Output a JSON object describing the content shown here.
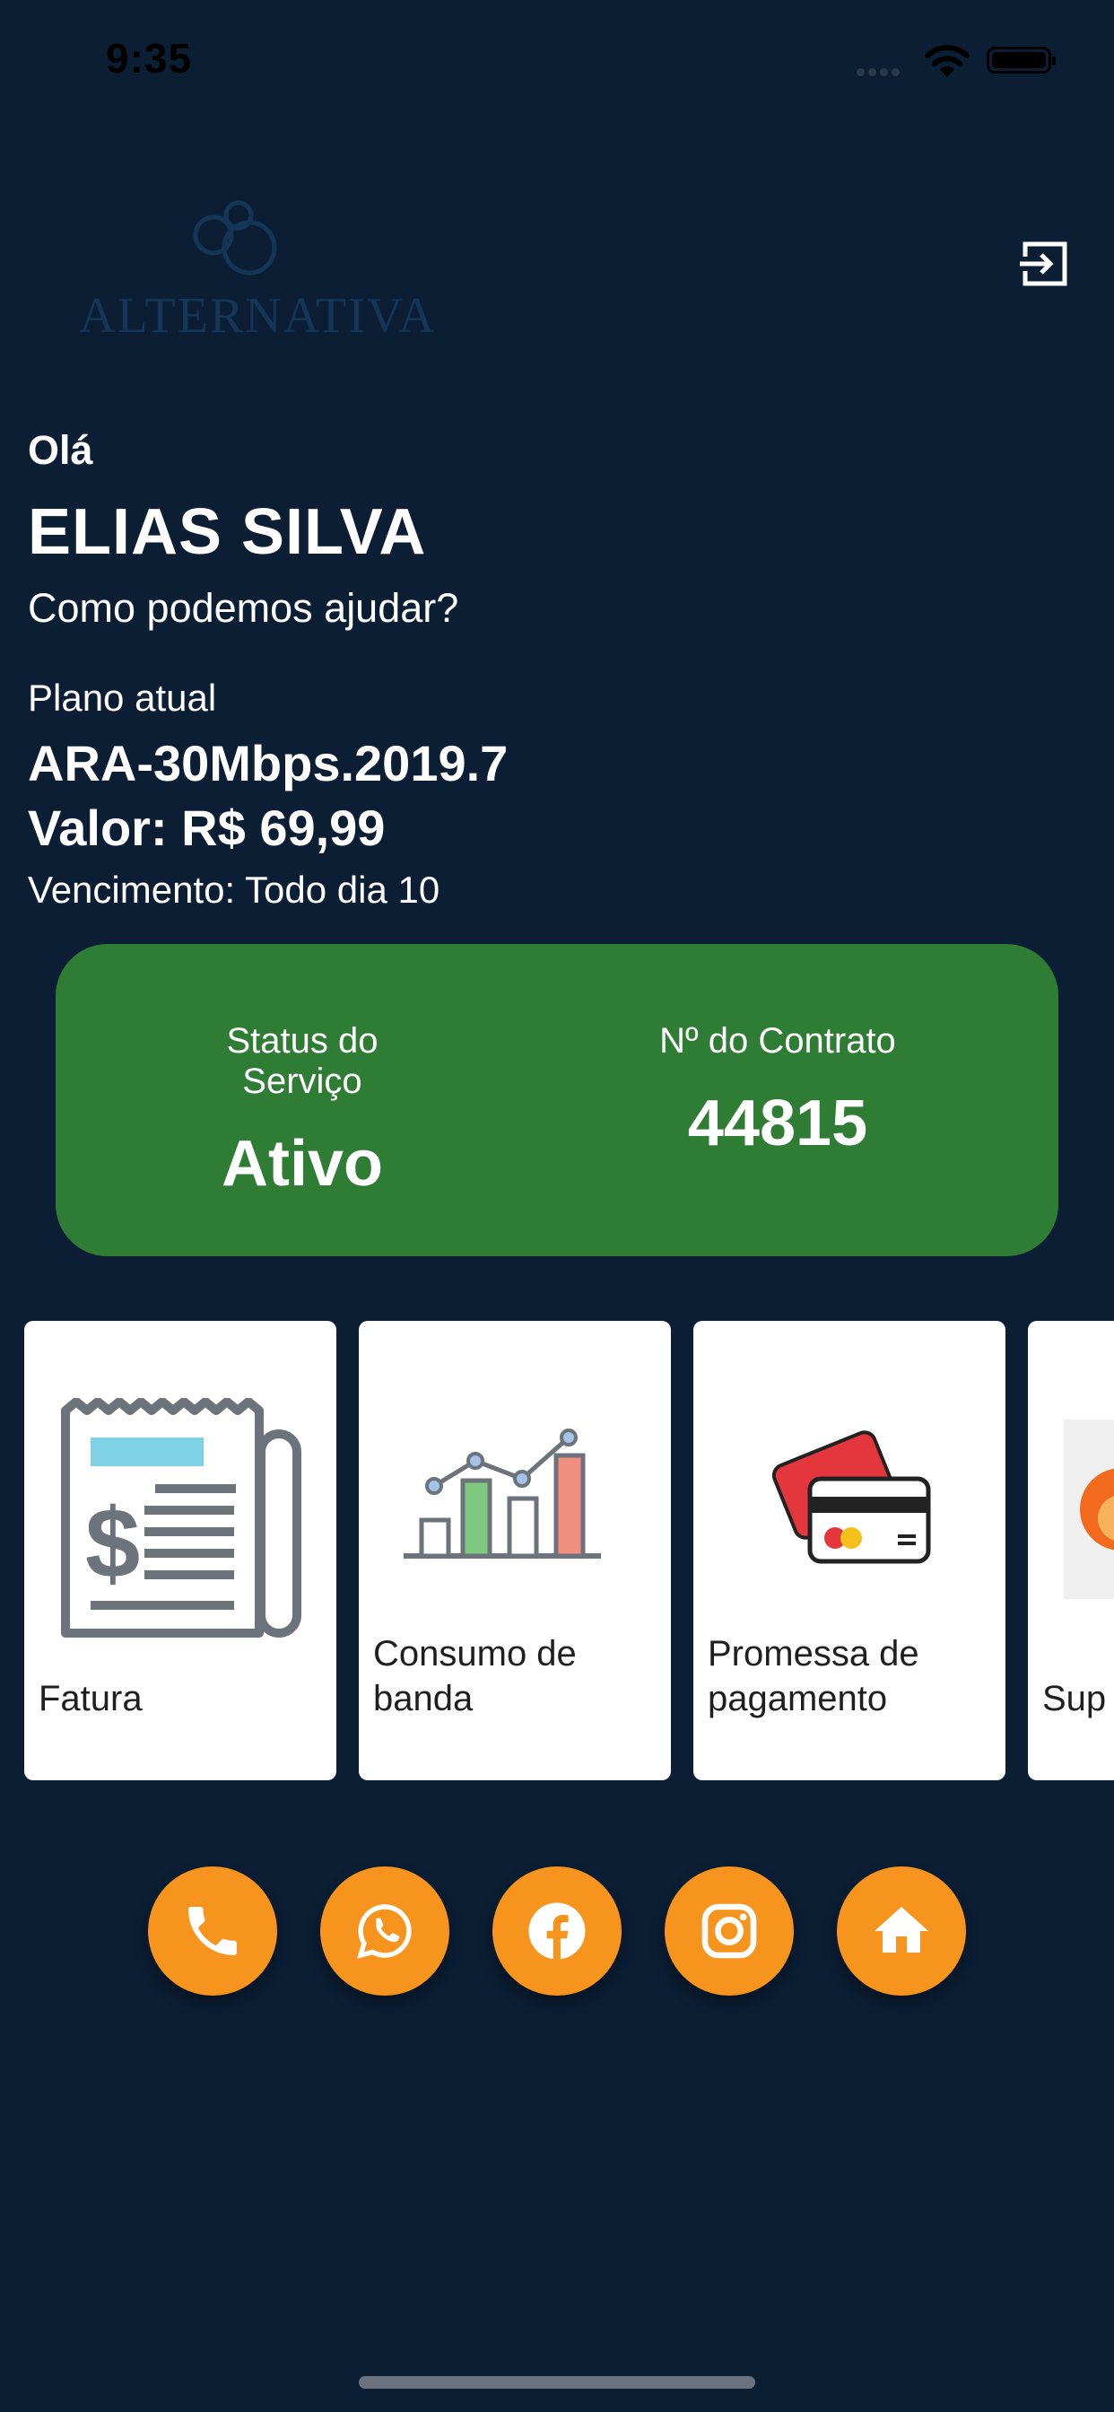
{
  "status_bar": {
    "time": "9:35"
  },
  "brand": {
    "logo_text": "ALTERNATIVA"
  },
  "greeting": {
    "hello": "Olá",
    "name": "ELIAS SILVA",
    "prompt": "Como podemos ajudar?"
  },
  "plan": {
    "label": "Plano atual",
    "name": "ARA-30Mbps.2019.7",
    "value": "Valor: R$ 69,99",
    "due": "Vencimento: Todo dia 10"
  },
  "service_card": {
    "status_label": "Status do Serviço",
    "status_value": "Ativo",
    "contract_label": "Nº do Contrato",
    "contract_value": "44815",
    "color": "#2f7d34"
  },
  "tiles": [
    {
      "label": "Fatura",
      "icon": "invoice-icon"
    },
    {
      "label": "Consumo de banda",
      "icon": "bandwidth-chart-icon"
    },
    {
      "label": "Promessa de pagamento",
      "icon": "payment-cards-icon"
    },
    {
      "label": "Sup",
      "icon": "support-icon"
    }
  ],
  "social_buttons": [
    {
      "name": "phone",
      "icon": "phone-icon"
    },
    {
      "name": "whatsapp",
      "icon": "whatsapp-icon"
    },
    {
      "name": "facebook",
      "icon": "facebook-icon"
    },
    {
      "name": "instagram",
      "icon": "instagram-icon"
    },
    {
      "name": "home",
      "icon": "home-icon"
    }
  ],
  "colors": {
    "background": "#0b1e34",
    "accent": "#f7941d",
    "card": "#2f7d34"
  }
}
